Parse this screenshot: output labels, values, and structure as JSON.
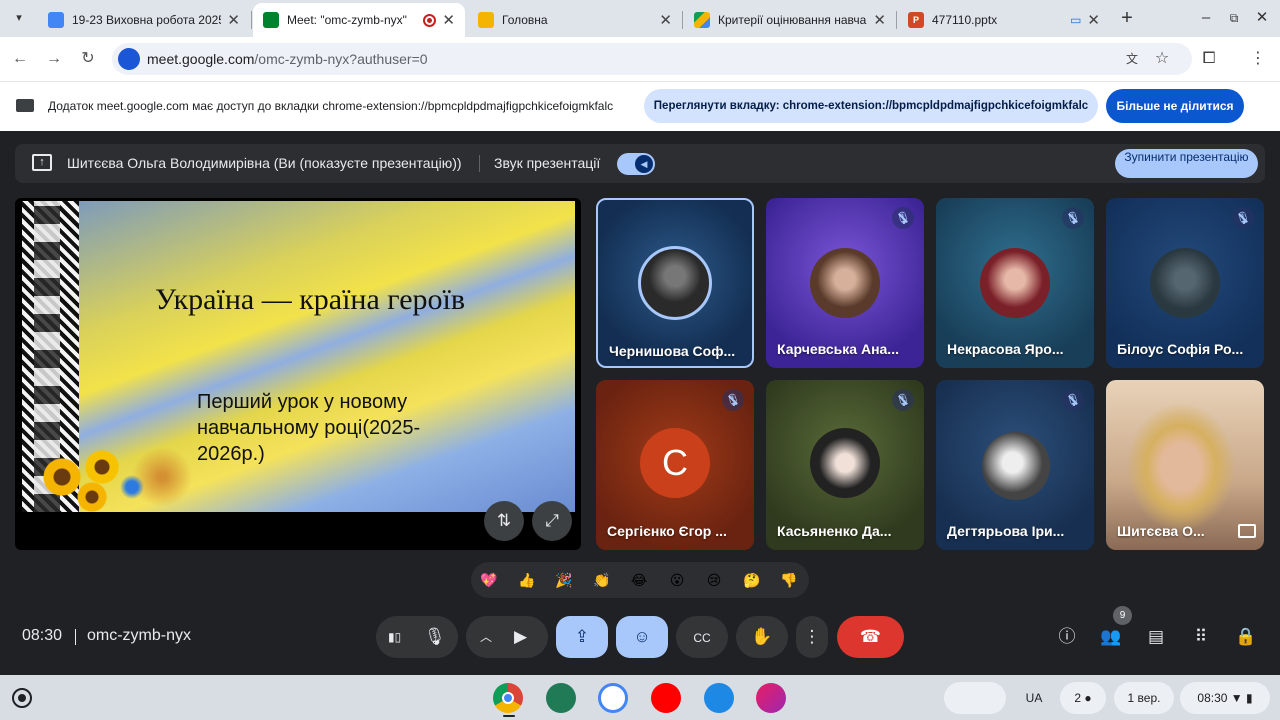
{
  "browser": {
    "tabs": [
      {
        "title": "19-23 Виховна робота 2025",
        "active": false,
        "favicon_color": "#4285f4"
      },
      {
        "title": "Meet: \"omc-zymb-nyx\"",
        "active": true,
        "favicon_color": "#00832d",
        "recording": true
      },
      {
        "title": "Головна",
        "active": false,
        "favicon_color": "#f4b400"
      },
      {
        "title": "Критерії оцінювання навча",
        "active": false,
        "favicon_color": "#0f9d58"
      },
      {
        "title": "477110.pptx",
        "active": false,
        "favicon_color": "#d24726",
        "favicon_letter": "P"
      }
    ],
    "new_tab_icon": "plus-icon",
    "url": {
      "host": "meet.google.com",
      "path": "/omc-zymb-nyx?authuser=0"
    }
  },
  "share_bar": {
    "text": "Додаток meet.google.com має доступ до вкладки chrome-extension://bpmcpldpdmajfigpchkicefoigmkfalc",
    "view_button": "Переглянути вкладку: chrome-extension://bpmcpldpdmajfigpchkicefoigmkfalc",
    "stop_button": "Більше не ділитися"
  },
  "meet": {
    "presenter_bar": {
      "presenter": "Шитєєва Ольга Володимирівна (Ви (показуєте презентацію))",
      "sound_label": "Звук презентації",
      "sound_on": true,
      "stop_button": "Зупинити презентацію"
    },
    "slide": {
      "title": "Україна — країна героїв",
      "subtitle": "Перший урок у новому навчальному році(2025-2026р.)"
    },
    "participants": [
      {
        "name": "Чернишова Соф...",
        "muted": false,
        "speaking": true,
        "bg": "#173a66",
        "avatar": "#3a3a3a"
      },
      {
        "name": "Карчевська Ана...",
        "muted": true,
        "bg": "#4b2bb0",
        "avatar": "#8a6a5a"
      },
      {
        "name": "Некрасова Яро...",
        "muted": true,
        "bg": "#1f4f6e",
        "avatar": "#7a3030"
      },
      {
        "name": "Білоус Софія Ро...",
        "muted": true,
        "bg": "#173a66",
        "avatar": "#3f4f58"
      },
      {
        "name": "Сергієнко Єгор ...",
        "muted": true,
        "bg": "#7a2a12",
        "initial": "С",
        "avatar": "#c9401a"
      },
      {
        "name": "Касьяненко Да...",
        "muted": true,
        "bg": "#3b4a25",
        "avatar": "#2a2a2a"
      },
      {
        "name": "Дегтярьова Іри...",
        "muted": true,
        "bg": "#1f3a5e",
        "avatar": "#6e6e6e"
      },
      {
        "name": "Шитєєва О...",
        "muted": false,
        "bg": "#c9a88a",
        "avatar": "#b07850",
        "self": true
      }
    ],
    "reactions": [
      "💖",
      "👍",
      "🎉",
      "👏",
      "😂",
      "😮",
      "😢",
      "🤔",
      "👎"
    ],
    "time": "08:30",
    "meeting_code": "omc-zymb-nyx",
    "participants_count": "9"
  },
  "shelf": {
    "lang": "UA",
    "notif_count": "2",
    "date": "1 вер.",
    "time": "08:30"
  }
}
